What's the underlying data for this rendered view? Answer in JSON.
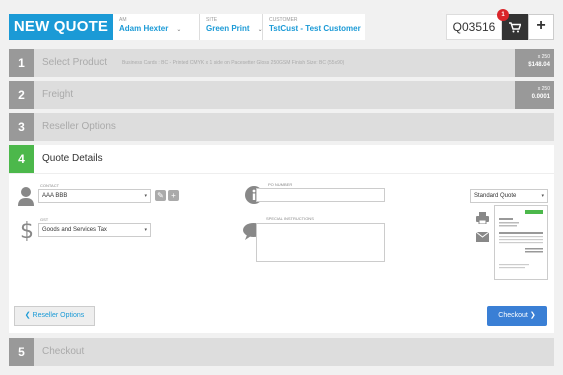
{
  "header": {
    "title": "NEW QUOTE",
    "am_label": "AM",
    "am_value": "Adam Hexter",
    "site_label": "SITE",
    "site_value": "Green Print",
    "customer_label": "CUSTOMER",
    "customer_value": "TstCust - Test Customer",
    "quote_number": "Q03516",
    "cart_count": "1",
    "plus": "+",
    "caret": "⌄"
  },
  "steps": [
    {
      "num": "1",
      "name": "Select Product",
      "desc": "Business Cards : BC - Printed CMYK x 1 side on Pacesetter Gloss 250GSM Finish Size: BC (55x90)",
      "qty": "x 250",
      "price": "$148.04"
    },
    {
      "num": "2",
      "name": "Freight",
      "qty": "x 250",
      "price": "0.0001"
    },
    {
      "num": "3",
      "name": "Reseller Options"
    },
    {
      "num": "4",
      "name": "Quote Details"
    },
    {
      "num": "5",
      "name": "Checkout"
    }
  ],
  "form": {
    "contact_label": "CONTACT",
    "contact_value": "AAA BBB",
    "gst_label": "GST",
    "gst_value": "Goods and Services Tax",
    "po_label": "PO NUMBER",
    "po_value": "",
    "si_label": "SPECIAL INSTRUCTIONS",
    "si_value": "",
    "template_value": "Standard Quote"
  },
  "buttons": {
    "back": "❮ Reseller Options",
    "checkout": "Checkout ❯"
  },
  "icons": {
    "edit": "✎",
    "add": "+",
    "dropdown": "▾"
  },
  "colors": {
    "accent": "#1b9ad6",
    "active_step": "#4cb84b",
    "checkout": "#3a7fd5",
    "badge": "#d9252a"
  }
}
